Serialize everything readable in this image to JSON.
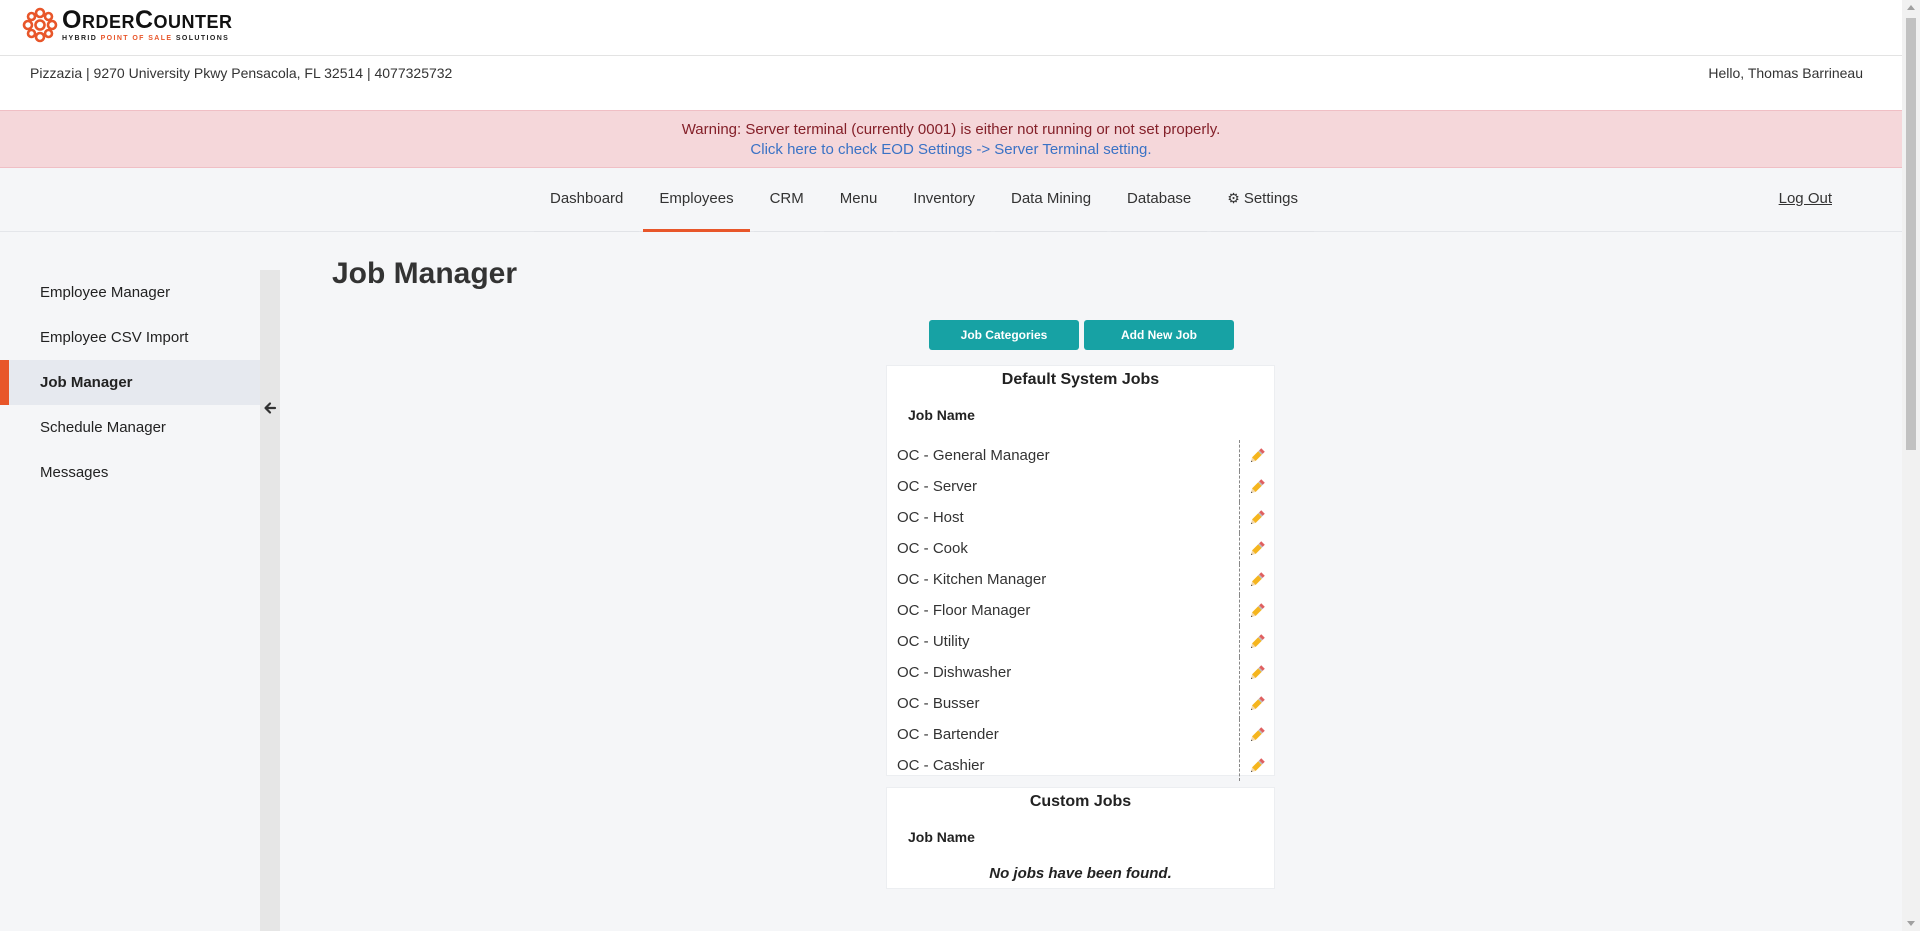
{
  "brand": {
    "name": "OrderCounter",
    "tagline_part1": "HYBRID ",
    "tagline_accent": "POINT OF SALE",
    "tagline_part2": " SOLUTIONS",
    "accent_color": "#e8562a"
  },
  "store": {
    "info": "Pizzazia | 9270 University Pkwy Pensacola, FL 32514 | 4077325732",
    "greeting": "Hello, Thomas Barrineau"
  },
  "warning": {
    "message": "Warning: Server terminal (currently 0001) is either not running or not set properly.",
    "link": "Click here to check EOD Settings -> Server Terminal setting."
  },
  "nav": {
    "items": [
      {
        "label": "Dashboard"
      },
      {
        "label": "Employees",
        "active": true
      },
      {
        "label": "CRM"
      },
      {
        "label": "Menu"
      },
      {
        "label": "Inventory"
      },
      {
        "label": "Data Mining"
      },
      {
        "label": "Database"
      },
      {
        "label": "Settings",
        "icon": "gear-icon"
      }
    ],
    "logout": "Log Out"
  },
  "sidebar": {
    "items": [
      {
        "label": "Employee Manager"
      },
      {
        "label": "Employee CSV Import"
      },
      {
        "label": "Job Manager",
        "active": true
      },
      {
        "label": "Schedule Manager"
      },
      {
        "label": "Messages"
      }
    ]
  },
  "main": {
    "title": "Job Manager",
    "buttons": {
      "categories": "Job Categories",
      "add": "Add New Job"
    },
    "default_jobs": {
      "title": "Default System Jobs",
      "column": "Job Name",
      "jobs": [
        "OC - General Manager",
        "OC - Server",
        "OC - Host",
        "OC - Cook",
        "OC - Kitchen Manager",
        "OC - Floor Manager",
        "OC - Utility",
        "OC - Dishwasher",
        "OC - Busser",
        "OC - Bartender",
        "OC - Cashier"
      ]
    },
    "custom_jobs": {
      "title": "Custom Jobs",
      "column": "Job Name",
      "empty": "No jobs have been found."
    }
  }
}
